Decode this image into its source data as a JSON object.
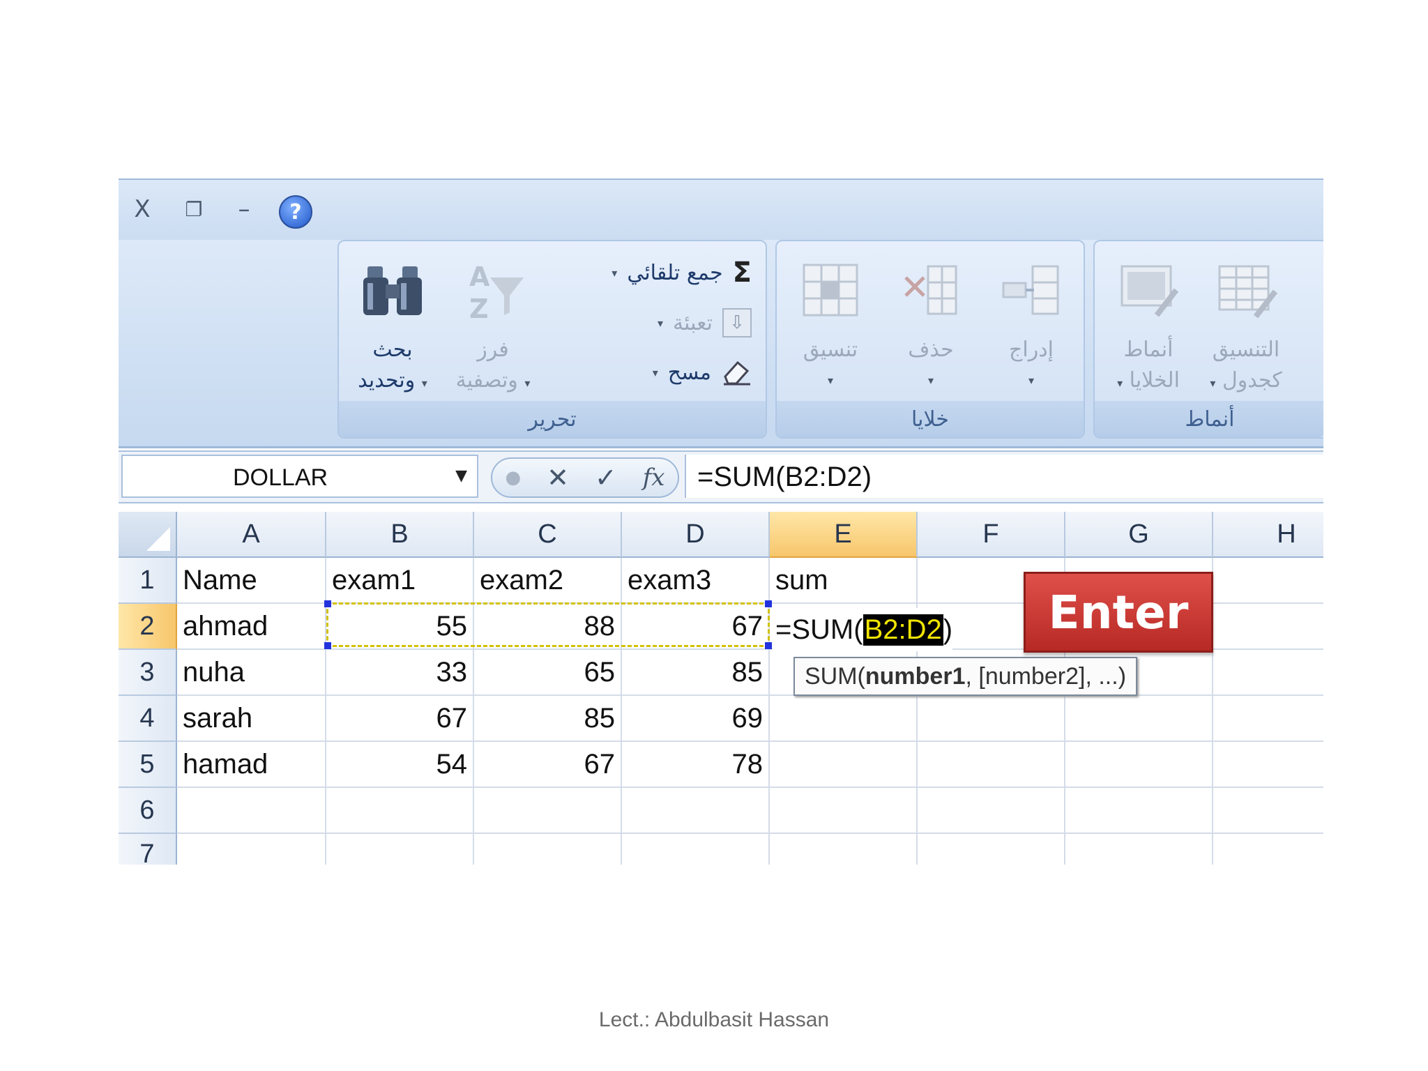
{
  "window": {
    "close": "X",
    "restore": "❐",
    "minimize": "–",
    "help": "?"
  },
  "ribbon": {
    "groups": [
      {
        "label": "تحرير",
        "find_select": [
          "بحث",
          "وتحديد"
        ],
        "sort_filter": [
          "فرز",
          "وتصفية"
        ],
        "autosum": "جمع تلقائي",
        "fill": "تعبئة",
        "clear": "مسح"
      },
      {
        "label": "خلايا",
        "format": "تنسيق",
        "delete": "حذف",
        "insert": "إدراج"
      },
      {
        "label": "أنماط",
        "cell_styles": [
          "أنماط",
          "الخلايا"
        ],
        "format_as_table": [
          "التنسيق",
          "كجدول"
        ]
      }
    ]
  },
  "formula_bar": {
    "name_box": "DOLLAR",
    "cancel": "✕",
    "enter": "✓",
    "fx": "fx",
    "formula": "=SUM(B2:D2)"
  },
  "sheet": {
    "columns": [
      "A",
      "B",
      "C",
      "D",
      "E",
      "F",
      "G",
      "H"
    ],
    "selected_column": "E",
    "rows": [
      "1",
      "2",
      "3",
      "4",
      "5",
      "6",
      "7"
    ],
    "selected_row": "2",
    "cells": [
      [
        "Name",
        "exam1",
        "exam2",
        "exam3",
        "sum"
      ],
      [
        "ahmad",
        "55",
        "88",
        "67",
        ""
      ],
      [
        "nuha",
        "33",
        "65",
        "85",
        ""
      ],
      [
        "sarah",
        "67",
        "85",
        "69",
        ""
      ],
      [
        "hamad",
        "54",
        "67",
        "78",
        ""
      ]
    ],
    "editing": {
      "prefix": "=SUM(",
      "ref": "B2:D2",
      "suffix": ")"
    },
    "tooltip": {
      "fn": "SUM(",
      "arg1": "number1",
      "rest": ", [number2], ...)"
    }
  },
  "overlay_button": "Enter",
  "footer": "Lect.: Abdulbasit Hassan"
}
